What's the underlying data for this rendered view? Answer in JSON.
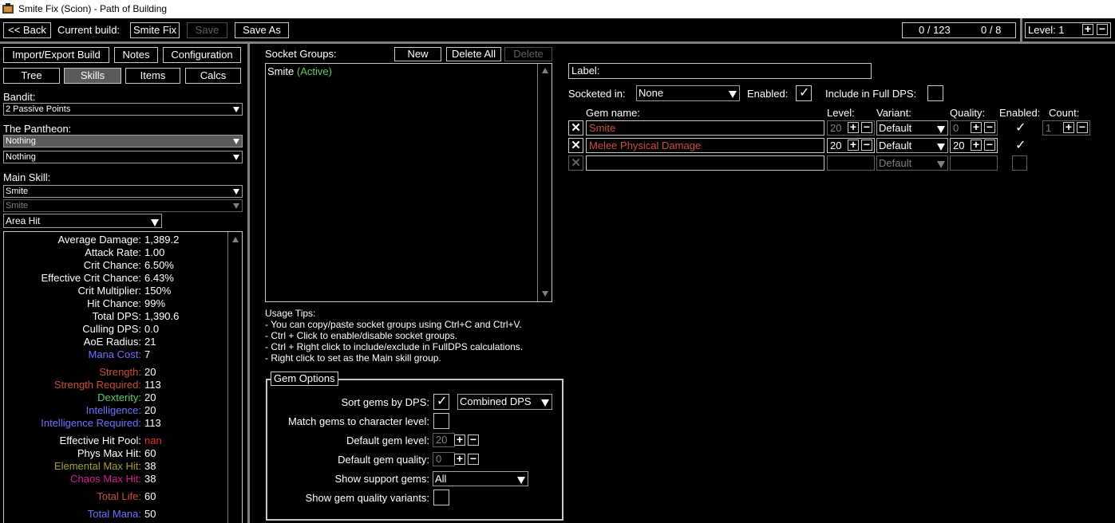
{
  "window": {
    "title": "Smite Fix (Scion) - Path of Building"
  },
  "topbar": {
    "back_label": "<< Back",
    "current_build_label": "Current build:",
    "build_name": "Smite Fix",
    "save_label": "Save",
    "save_as_label": "Save As",
    "points_readout": "0 / 123",
    "ascend_readout": "0 / 8",
    "level_label": "Level: 1",
    "plus": "+",
    "minus": "−"
  },
  "left": {
    "import_export": "Import/Export Build",
    "notes": "Notes",
    "configuration": "Configuration",
    "tabs": {
      "tree": "Tree",
      "skills": "Skills",
      "items": "Items",
      "calcs": "Calcs"
    },
    "bandit_label": "Bandit:",
    "bandit_value": "2 Passive Points",
    "pantheon_label": "The Pantheon:",
    "pantheon_major": "Nothing",
    "pantheon_minor": "Nothing",
    "main_skill_label": "Main Skill:",
    "main_skill": "Smite",
    "main_skill_part": "Smite",
    "skill_mode": "Area Hit",
    "stats": [
      {
        "k": "Average Damage:",
        "v": "1,389.2",
        "color": "#ffffff"
      },
      {
        "k": "Attack Rate:",
        "v": "1.00",
        "color": "#ffffff"
      },
      {
        "k": "Crit Chance:",
        "v": "6.50%",
        "color": "#ffffff"
      },
      {
        "k": "Effective Crit Chance:",
        "v": "6.43%",
        "color": "#ffffff"
      },
      {
        "k": "Crit Multiplier:",
        "v": "150%",
        "color": "#ffffff"
      },
      {
        "k": "Hit Chance:",
        "v": "99%",
        "color": "#ffffff"
      },
      {
        "k": "Total DPS:",
        "v": "1,390.6",
        "color": "#ffffff"
      },
      {
        "k": "Culling DPS:",
        "v": "0.0",
        "color": "#ffffff"
      },
      {
        "k": "AoE Radius:",
        "v": "21",
        "color": "#ffffff"
      },
      {
        "k": "Mana Cost:",
        "v": "7",
        "color": "#7070ff"
      },
      {
        "k": "Strength:",
        "v": "20",
        "color": "#c8503c"
      },
      {
        "k": "Strength Required:",
        "v": "113",
        "color": "#c8503c"
      },
      {
        "k": "Dexterity:",
        "v": "20",
        "color": "#64c864"
      },
      {
        "k": "Intelligence:",
        "v": "20",
        "color": "#7070ff"
      },
      {
        "k": "Intelligence Required:",
        "v": "113",
        "color": "#7070ff"
      },
      {
        "k": "Effective Hit Pool:",
        "v": "nan",
        "color": "#ffffff",
        "vcolor": "#e03232"
      },
      {
        "k": "Phys Max Hit:",
        "v": "60",
        "color": "#ffffff"
      },
      {
        "k": "Elemental Max Hit:",
        "v": "38",
        "color": "#a0a030"
      },
      {
        "k": "Chaos Max Hit:",
        "v": "38",
        "color": "#d02090"
      },
      {
        "k": "Total Life:",
        "v": "60",
        "color": "#c8503c"
      },
      {
        "k": "Total Mana:",
        "v": "50",
        "color": "#7070ff"
      }
    ]
  },
  "socket_groups": {
    "label": "Socket Groups:",
    "new": "New",
    "delete_all": "Delete All",
    "delete": "Delete",
    "items": [
      {
        "name": "Smite",
        "status": "(Active)"
      }
    ]
  },
  "usage_tips": {
    "title": "Usage Tips:",
    "lines": [
      "- You can copy/paste socket groups using Ctrl+C and Ctrl+V.",
      "- Ctrl + Click to enable/disable socket groups.",
      "- Ctrl + Right click to include/exclude in FullDPS calculations.",
      "- Right click to set as the Main skill group."
    ]
  },
  "gem_options": {
    "title": "Gem Options",
    "sort_label": "Sort gems by DPS:",
    "sort_mode": "Combined DPS",
    "match_label": "Match gems to character level:",
    "def_level_label": "Default gem level:",
    "def_level": "20",
    "def_quality_label": "Default gem quality:",
    "def_quality": "0",
    "show_support_label": "Show support gems:",
    "show_support": "All",
    "show_variants_label": "Show gem quality variants:"
  },
  "group_editor": {
    "label_label": "Label:",
    "socketed_label": "Socketed in:",
    "socketed_value": "None",
    "enabled_label": "Enabled:",
    "full_dps_label": "Include in Full DPS:",
    "headers": {
      "gem_name": "Gem name:",
      "level": "Level:",
      "variant": "Variant:",
      "quality": "Quality:",
      "enabled": "Enabled:",
      "count": "Count:"
    },
    "gems": [
      {
        "name": "Smite",
        "level": "20",
        "variant": "Default",
        "quality": "0",
        "count": "1"
      },
      {
        "name": "Melee Physical Damage",
        "level": "20",
        "variant": "Default",
        "quality": "20"
      }
    ],
    "empty_variant": "Default",
    "check": "✓",
    "x": "✕"
  }
}
